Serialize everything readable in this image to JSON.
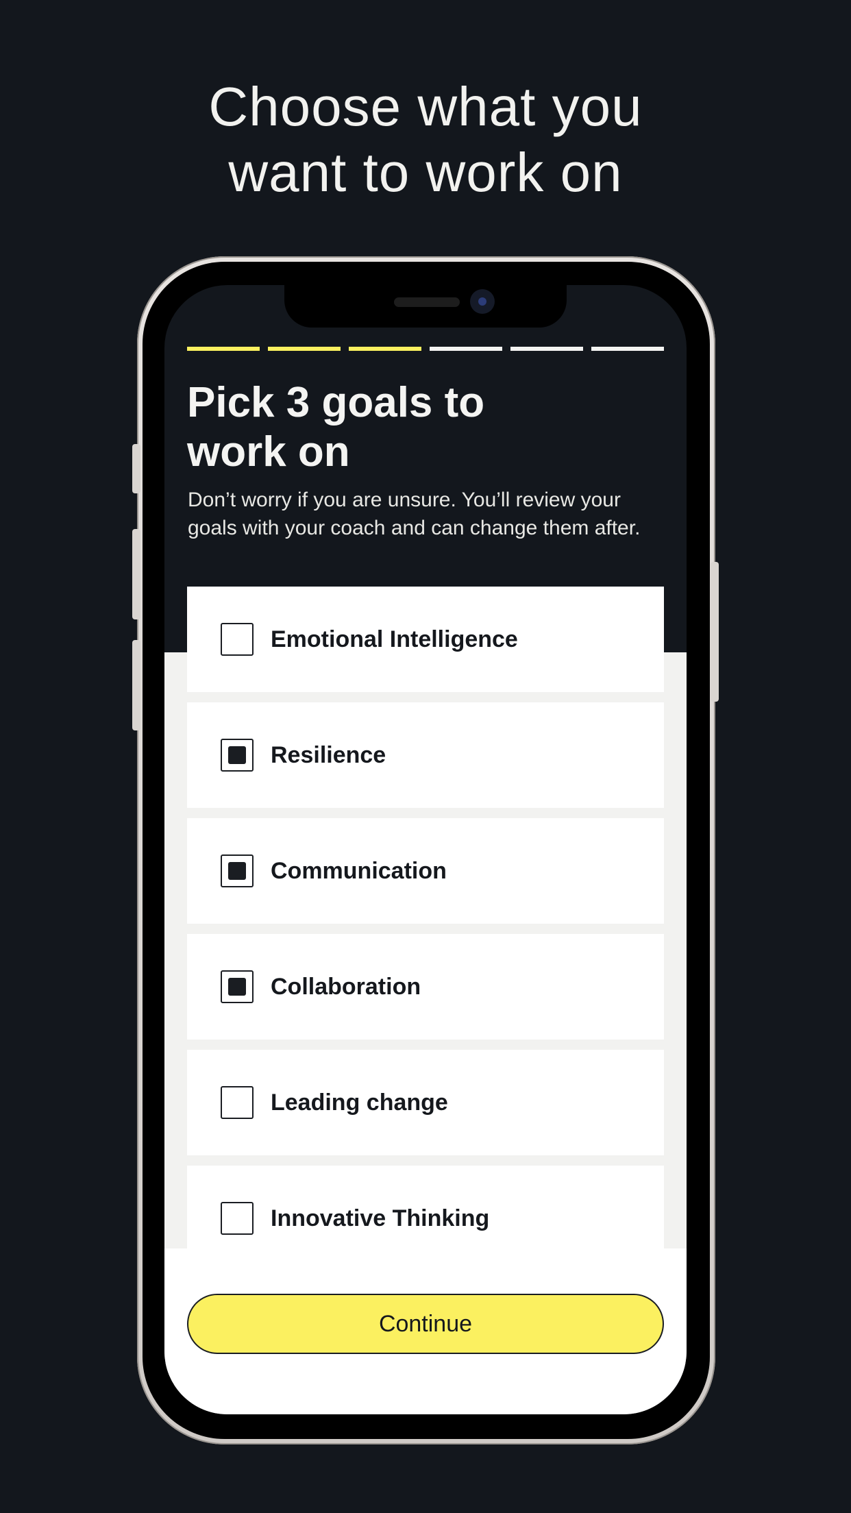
{
  "promo": {
    "title_line1": "Choose what you",
    "title_line2": "want to work on"
  },
  "progress": {
    "total_steps": 6,
    "completed_steps": 3
  },
  "onboarding": {
    "heading": "Pick 3 goals to work on",
    "subtext": "Don’t worry if you are unsure. You’ll review your goals with your coach and can change them after."
  },
  "goals": [
    {
      "label": "Emotional Intelligence",
      "checked": false
    },
    {
      "label": "Resilience",
      "checked": true
    },
    {
      "label": "Communication",
      "checked": true
    },
    {
      "label": "Collaboration",
      "checked": true
    },
    {
      "label": "Leading change",
      "checked": false
    },
    {
      "label": "Innovative Thinking",
      "checked": false
    }
  ],
  "actions": {
    "continue_label": "Continue"
  },
  "colors": {
    "background": "#13171d",
    "accent_yellow": "#fbf060",
    "card": "#ffffff",
    "text_dark": "#15181d"
  }
}
